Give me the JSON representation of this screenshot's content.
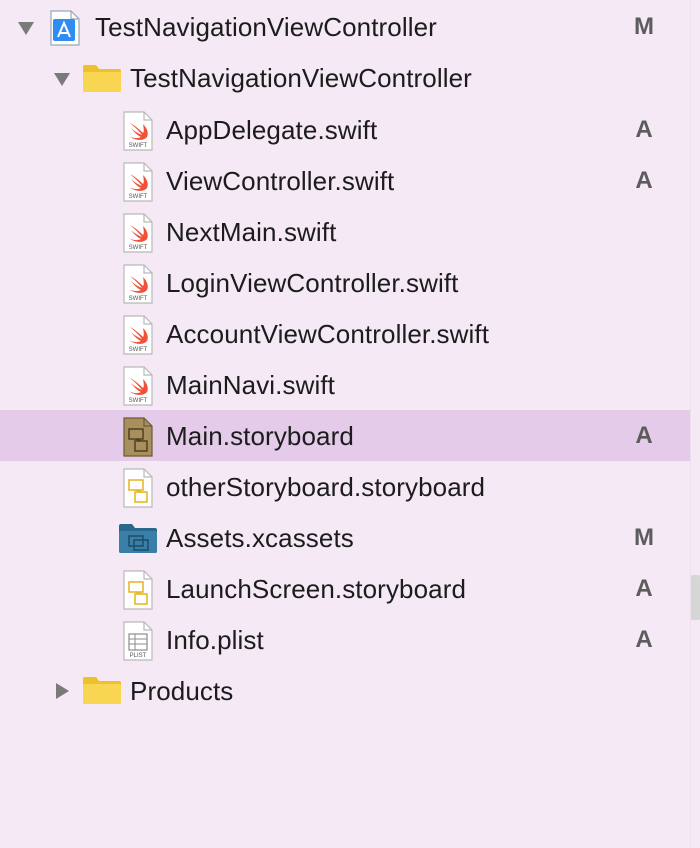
{
  "navigator": {
    "project": {
      "label": "TestNavigationViewController",
      "status": "M",
      "icon": "xcode-project-icon"
    },
    "group": {
      "label": "TestNavigationViewController",
      "status": "",
      "icon": "folder-icon"
    },
    "files": [
      {
        "label": "AppDelegate.swift",
        "status": "A",
        "icon": "swift-file-icon",
        "icon_text": "SWIFT"
      },
      {
        "label": "ViewController.swift",
        "status": "A",
        "icon": "swift-file-icon",
        "icon_text": "SWIFT"
      },
      {
        "label": "NextMain.swift",
        "status": "",
        "icon": "swift-file-icon",
        "icon_text": "SWIFT"
      },
      {
        "label": "LoginViewController.swift",
        "status": "",
        "icon": "swift-file-icon",
        "icon_text": "SWIFT"
      },
      {
        "label": "AccountViewController.swift",
        "status": "",
        "icon": "swift-file-icon",
        "icon_text": "SWIFT"
      },
      {
        "label": "MainNavi.swift",
        "status": "",
        "icon": "swift-file-icon",
        "icon_text": "SWIFT"
      },
      {
        "label": "Main.storyboard",
        "status": "A",
        "icon": "storyboard-file-icon",
        "selected": true
      },
      {
        "label": "otherStoryboard.storyboard",
        "status": "",
        "icon": "storyboard-file-icon"
      },
      {
        "label": "Assets.xcassets",
        "status": "M",
        "icon": "asset-catalog-icon"
      },
      {
        "label": "LaunchScreen.storyboard",
        "status": "A",
        "icon": "storyboard-file-icon"
      },
      {
        "label": "Info.plist",
        "status": "A",
        "icon": "plist-file-icon",
        "icon_text": "PLIST"
      }
    ],
    "products": {
      "label": "Products",
      "status": "",
      "icon": "folder-icon"
    }
  },
  "colors": {
    "background": "#f4e9f4",
    "selection": "#e3cbe9",
    "folder": "#f5cf4a",
    "swift": "#f05138",
    "asset_folder": "#2f6f95"
  }
}
